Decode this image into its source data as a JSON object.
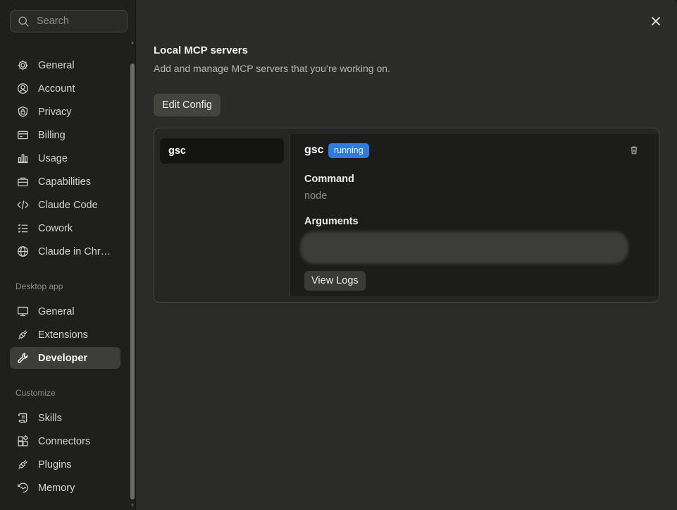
{
  "search": {
    "placeholder": "Search"
  },
  "sidebar": {
    "settings_items": [
      {
        "label": "General",
        "icon": "gear-icon"
      },
      {
        "label": "Account",
        "icon": "user-circle-icon"
      },
      {
        "label": "Privacy",
        "icon": "lock-shield-icon"
      },
      {
        "label": "Billing",
        "icon": "credit-card-icon"
      },
      {
        "label": "Usage",
        "icon": "bar-chart-icon"
      },
      {
        "label": "Capabilities",
        "icon": "briefcase-icon"
      },
      {
        "label": "Claude Code",
        "icon": "code-icon"
      },
      {
        "label": "Cowork",
        "icon": "checklist-icon"
      },
      {
        "label": "Claude in Chr…",
        "icon": "globe-icon"
      }
    ],
    "desktop_section": "Desktop app",
    "desktop_items": [
      {
        "label": "General",
        "icon": "monitor-icon"
      },
      {
        "label": "Extensions",
        "icon": "plug-icon"
      },
      {
        "label": "Developer",
        "icon": "wrench-icon",
        "active": true
      }
    ],
    "customize_section": "Customize",
    "customize_items": [
      {
        "label": "Skills",
        "icon": "scroll-icon"
      },
      {
        "label": "Connectors",
        "icon": "blocks-icon"
      },
      {
        "label": "Plugins",
        "icon": "plug-icon"
      },
      {
        "label": "Memory",
        "icon": "memory-icon"
      }
    ]
  },
  "main": {
    "title": "Local MCP servers",
    "subtitle": "Add and manage MCP servers that you’re working on.",
    "edit_config_label": "Edit Config",
    "servers": [
      {
        "name": "gsc"
      }
    ],
    "detail": {
      "name": "gsc",
      "status": "running",
      "command_label": "Command",
      "command_value": "node",
      "arguments_label": "Arguments",
      "view_logs_label": "View Logs"
    }
  },
  "colors": {
    "accent_badge": "#2f7be0",
    "background": "#2b2b29",
    "sidebar": "#1f1f1e"
  }
}
